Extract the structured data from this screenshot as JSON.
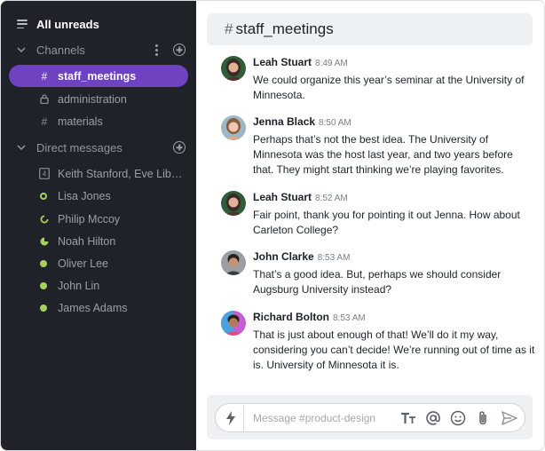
{
  "sidebar": {
    "all_unreads": "All unreads",
    "channels_header": "Channels",
    "channels": [
      {
        "label": "staff_meetings",
        "glyph": "#",
        "active": true
      },
      {
        "label": "administration",
        "glyph": "lock"
      },
      {
        "label": "materials",
        "glyph": "#"
      }
    ],
    "dm_header": "Direct messages",
    "direct_messages": [
      {
        "label": "Keith Stanford, Eve Libe...",
        "status": "group-4",
        "badge": "4"
      },
      {
        "label": "Lisa Jones",
        "status": "online-ring"
      },
      {
        "label": "Philip Mccoy",
        "status": "partial"
      },
      {
        "label": "Noah Hilton",
        "status": "partial-alt"
      },
      {
        "label": "Oliver Lee",
        "status": "online"
      },
      {
        "label": "John Lin",
        "status": "online"
      },
      {
        "label": "James Adams",
        "status": "online"
      }
    ]
  },
  "channel": {
    "hash": "#",
    "name": "staff_meetings"
  },
  "messages": [
    {
      "author": "Leah Stuart",
      "time": "8:49 AM",
      "text": "We could organize this year’s seminar at the University of Minnesota."
    },
    {
      "author": "Jenna Black",
      "time": "8:50 AM",
      "text": "Perhaps that’s not the best idea. The University of Minnesota was the host last year, and two years before that. They might start thinking we’re playing favorites."
    },
    {
      "author": "Leah Stuart",
      "time": "8:52 AM",
      "text": "Fair point, thank you for pointing it out Jenna. How about Carleton College?"
    },
    {
      "author": "John Clarke",
      "time": "8:53 AM",
      "text": "That’s a good idea. But, perhaps we should consider Augsburg University instead?"
    },
    {
      "author": "Richard Bolton",
      "time": "8:53 AM",
      "text": "That is just about enough of that! We’ll do it my way, considering you can’t decide! We’re running out of time as it is. University of Minnesota it is."
    }
  ],
  "composer": {
    "placeholder": "Message #product-design"
  },
  "colors": {
    "sidebar_bg": "#1f2329",
    "active_channel": "#6f42c1",
    "online": "#a6d15f"
  }
}
